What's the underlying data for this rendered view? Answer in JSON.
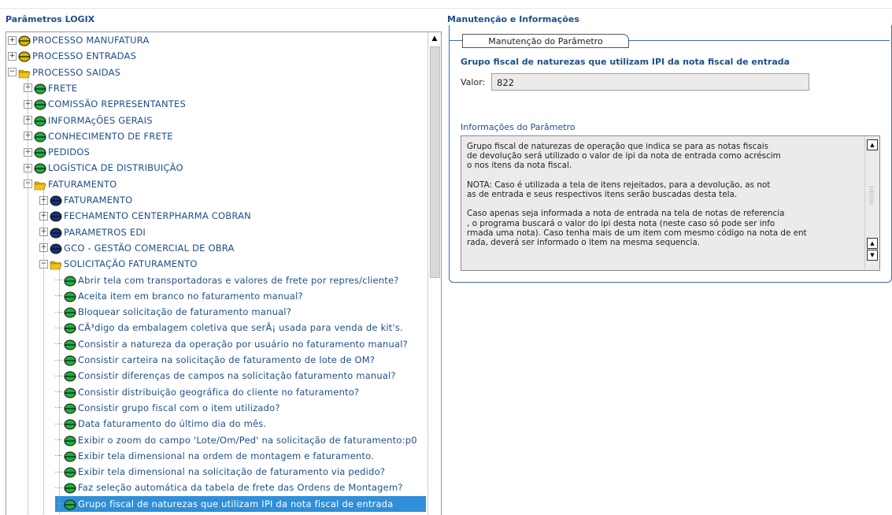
{
  "left_panel": {
    "title": "Parâmetros LOGIX"
  },
  "right_panel": {
    "title": "Manutenção e Informações",
    "fieldset_legend": "Manutenção do Parâmetro",
    "parameter_name": "Grupo fiscal de naturezas que utilizam IPI da nota fiscal de entrada",
    "value_label": "Valor:",
    "value": "822",
    "info_label": "Informações do Parâmetro",
    "info_text": "Grupo fiscal de naturezas de operação que indica se para as notas fiscais\nde devolução será utilizado o valor de ipi da nota de entrada como acréscim\no nos itens da nota fiscal.\n\nNOTA: Caso é utilizada a tela de itens rejeitados, para a devolução, as not\nas de entrada e seus respectivos itens serão buscadas desta tela.\n\nCaso apenas seja informada a nota de entrada na tela de notas de referencia\n, o programa buscará o valor do ipi desta nota (neste caso só pode ser info\nrmada uma nota). Caso tenha mais de um item com mesmo código na nota de ent\nrada, deverá ser informado o item na mesma sequencia."
  },
  "tree": [
    {
      "label": "PROCESSO MANUFATURA",
      "level": 0,
      "icon": "yellow-bullet-icon",
      "expander": "+"
    },
    {
      "label": "PROCESSO ENTRADAS",
      "level": 0,
      "icon": "yellow-bullet-icon",
      "expander": "+"
    },
    {
      "label": "PROCESSO SAIDAS",
      "level": 0,
      "icon": "open-folder-icon",
      "expander": "-"
    },
    {
      "label": "FRETE",
      "level": 1,
      "icon": "green-bullet-icon",
      "expander": "+"
    },
    {
      "label": "COMISSÃO REPRESENTANTES",
      "level": 1,
      "icon": "green-bullet-icon",
      "expander": "+"
    },
    {
      "label": "INFORMAçÕES GERAIS",
      "level": 1,
      "icon": "green-bullet-icon",
      "expander": "+"
    },
    {
      "label": "CONHECIMENTO DE FRETE",
      "level": 1,
      "icon": "green-bullet-icon",
      "expander": "+"
    },
    {
      "label": "PEDIDOS",
      "level": 1,
      "icon": "green-bullet-icon",
      "expander": "+"
    },
    {
      "label": "LOGÍSTICA DE DISTRIBUIÇÃO",
      "level": 1,
      "icon": "green-bullet-icon",
      "expander": "+"
    },
    {
      "label": "FATURAMENTO",
      "level": 1,
      "icon": "open-folder-icon",
      "expander": "-"
    },
    {
      "label": "FATURAMENTO",
      "level": 2,
      "icon": "navy-bullet-icon",
      "expander": "+"
    },
    {
      "label": "FECHAMENTO CENTERPHARMA COBRAN",
      "level": 2,
      "icon": "navy-bullet-icon",
      "expander": "+"
    },
    {
      "label": "PARAMETROS EDI",
      "level": 2,
      "icon": "navy-bullet-icon",
      "expander": "+"
    },
    {
      "label": "GCO - GESTÃO COMERCIAL DE OBRA",
      "level": 2,
      "icon": "navy-bullet-icon",
      "expander": "+"
    },
    {
      "label": "SOLICITAÇÃO FATURAMENTO",
      "level": 2,
      "icon": "open-folder-icon",
      "expander": "-"
    },
    {
      "label": "Abrir tela com transportadoras e valores de frete por repres/cliente?",
      "level": 3,
      "icon": "green-leaf-icon"
    },
    {
      "label": "Aceita item em branco no faturamento manual?",
      "level": 3,
      "icon": "green-leaf-icon"
    },
    {
      "label": "Bloquear solicitação de faturamento manual?",
      "level": 3,
      "icon": "green-leaf-icon"
    },
    {
      "label": "CÃ³digo da embalagem coletiva que serÃ¡ usada para venda de kit's.",
      "level": 3,
      "icon": "green-leaf-icon"
    },
    {
      "label": "Consistir a natureza da operação por usuário no faturamento manual?",
      "level": 3,
      "icon": "green-leaf-icon"
    },
    {
      "label": "Consistir carteira na solicitação de faturamento de lote de OM?",
      "level": 3,
      "icon": "green-leaf-icon"
    },
    {
      "label": "Consistir diferenças de campos na solicitação faturamento manual?",
      "level": 3,
      "icon": "green-leaf-icon"
    },
    {
      "label": "Consistir distribuição geográfica do cliente no faturamento?",
      "level": 3,
      "icon": "green-leaf-icon"
    },
    {
      "label": "Consistir grupo fiscal com o item utilizado?",
      "level": 3,
      "icon": "green-leaf-icon"
    },
    {
      "label": "Data faturamento do último dia do mês.",
      "level": 3,
      "icon": "green-leaf-icon"
    },
    {
      "label": "Exibir o zoom do campo 'Lote/Om/Ped' na solicitação de faturamento:p0",
      "level": 3,
      "icon": "green-leaf-icon"
    },
    {
      "label": "Exibir tela dimensional na ordem de montagem e faturamento.",
      "level": 3,
      "icon": "green-leaf-icon"
    },
    {
      "label": "Exibir tela dimensional na solicitação de faturamento via pedido?",
      "level": 3,
      "icon": "green-leaf-icon"
    },
    {
      "label": "Faz seleção automática da tabela de frete das Ordens de Montagem?",
      "level": 3,
      "icon": "green-leaf-icon"
    },
    {
      "label": "Grupo fiscal de naturezas que utilizam IPI da nota fiscal de entrada",
      "level": 3,
      "icon": "green-leaf-icon",
      "selected": true
    }
  ],
  "colors": {
    "link": "#1f4e8c",
    "selection": "#2f8fd8",
    "yellow_bullet": "#d8b800",
    "green_bullet": "#1fae3f",
    "navy_bullet": "#1b2f7a",
    "folder": "#f0c419"
  }
}
